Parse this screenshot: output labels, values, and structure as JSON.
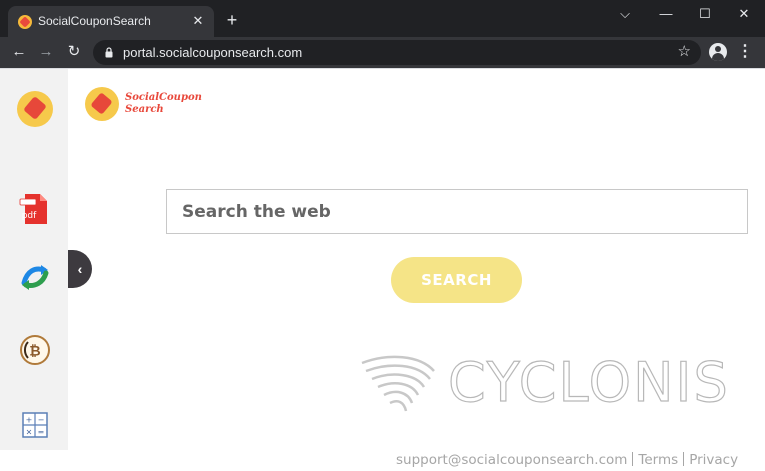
{
  "browser": {
    "tab_title": "SocialCouponSearch",
    "tab_close": "✕",
    "new_tab": "+",
    "url": "portal.socialcouponsearch.com",
    "window_controls": {
      "tab_search": "⌵",
      "minimize": "—",
      "maximize": "☐",
      "close": "✕"
    },
    "nav": {
      "back": "←",
      "forward": "→",
      "reload": "↻"
    },
    "star": "☆",
    "menu": "⋮"
  },
  "sidebar": {
    "items": [
      {
        "name": "social-coupon-search-logo-icon"
      },
      {
        "name": "pdf-icon",
        "label": "pdf"
      },
      {
        "name": "converter-arrows-icon"
      },
      {
        "name": "bitcoin-icon"
      },
      {
        "name": "calculator-icon"
      }
    ],
    "collapse_glyph": "‹"
  },
  "brand": {
    "name_line1": "SocialCoupon",
    "name_line2": "Search"
  },
  "search": {
    "placeholder": "Search the web",
    "value": "",
    "button_label": "SEARCH"
  },
  "watermark": {
    "text": "CYCLONIS"
  },
  "footer": {
    "email": "support@socialcouponsearch.com",
    "terms": "Terms",
    "privacy": "Privacy"
  },
  "colors": {
    "accent_yellow": "#f5e487",
    "brand_red": "#e8483b",
    "chrome_dark": "#202124",
    "toolbar": "#35363a"
  }
}
